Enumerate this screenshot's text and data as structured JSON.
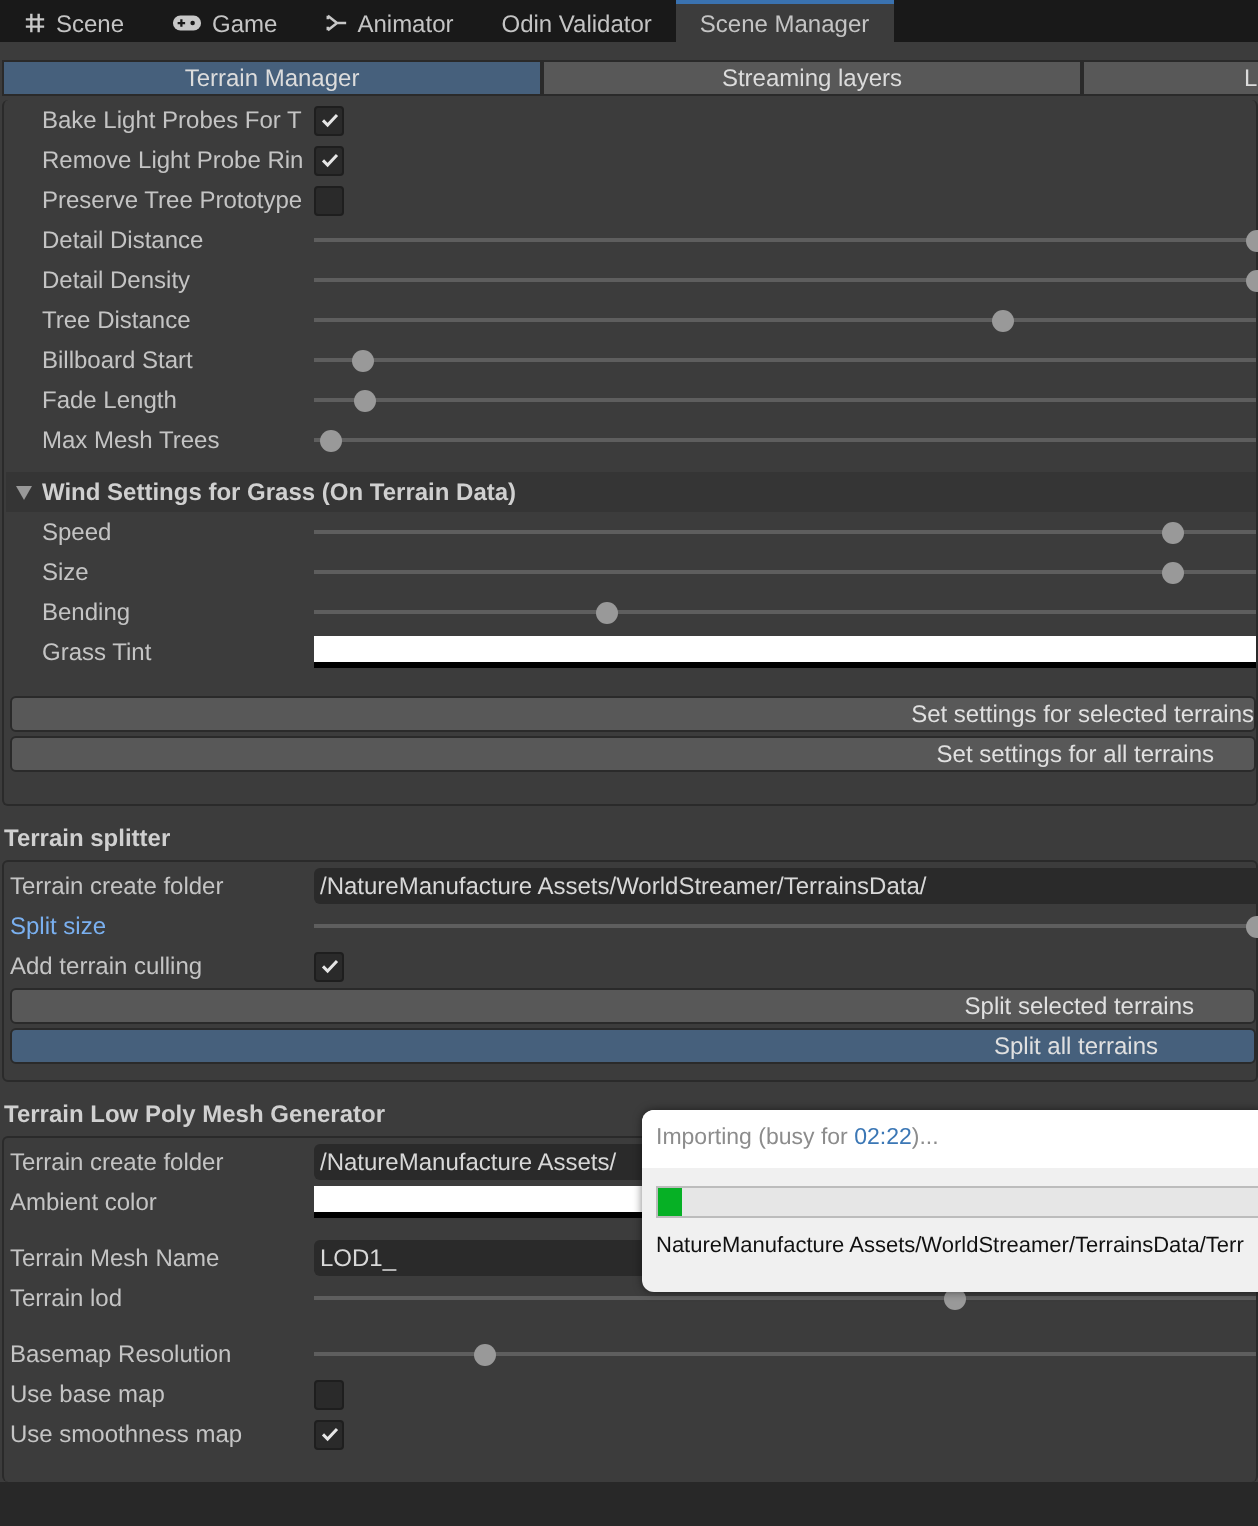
{
  "window_tabs": [
    {
      "label": "Scene",
      "selected": false
    },
    {
      "label": "Game",
      "selected": false
    },
    {
      "label": "Animator",
      "selected": false
    },
    {
      "label": "Odin Validator",
      "selected": false
    },
    {
      "label": "Scene Manager",
      "selected": true
    }
  ],
  "toolbar_tabs": [
    {
      "label": "Terrain Manager",
      "selected": true
    },
    {
      "label": "Streaming layers",
      "selected": false
    },
    {
      "label": "L",
      "selected": false
    }
  ],
  "terrain_settings": {
    "rows": [
      {
        "kind": "checkbox",
        "label": "Bake Light Probes For T",
        "checked": true
      },
      {
        "kind": "checkbox",
        "label": "Remove Light Probe Rin",
        "checked": true
      },
      {
        "kind": "checkbox",
        "label": "Preserve Tree Prototype",
        "checked": false
      },
      {
        "kind": "slider",
        "label": "Detail Distance",
        "level": 1
      },
      {
        "kind": "slider",
        "label": "Detail Density",
        "level": 1
      },
      {
        "kind": "slider",
        "label": "Tree Distance",
        "level": 0.73
      },
      {
        "kind": "slider",
        "label": "Billboard Start",
        "level": 0.05
      },
      {
        "kind": "slider",
        "label": "Fade Length",
        "level": 0.053
      },
      {
        "kind": "slider",
        "label": "Max Mesh Trees",
        "level": 0.017
      }
    ],
    "wind": {
      "title": "Wind Settings for Grass (On Terrain Data)",
      "expanded": true,
      "rows": [
        {
          "kind": "slider",
          "label": "Speed",
          "level": 0.91
        },
        {
          "kind": "slider",
          "label": "Size",
          "level": 0.91
        },
        {
          "kind": "slider",
          "label": "Bending",
          "level": 0.31
        },
        {
          "kind": "color",
          "label": "Grass Tint",
          "color": "#ffffff"
        }
      ]
    },
    "buttons": [
      {
        "label": "Set settings for selected terrains",
        "selected": false
      },
      {
        "label": "Set settings for all terrains",
        "selected": false
      }
    ]
  },
  "terrain_splitter": {
    "title": "Terrain splitter",
    "rows": [
      {
        "kind": "text",
        "label": "Terrain create folder",
        "value": "/NatureManufacture Assets/WorldStreamer/TerrainsData/"
      },
      {
        "kind": "slider",
        "label": "Split size",
        "modified": true,
        "level": 1
      },
      {
        "kind": "checkbox",
        "label": "Add terrain culling",
        "checked": true
      }
    ],
    "buttons": [
      {
        "label": "Split selected terrains",
        "selected": false
      },
      {
        "label": "Split all terrains",
        "selected": true
      }
    ]
  },
  "mesh_generator": {
    "title": "Terrain Low Poly Mesh Generator",
    "rows": [
      {
        "kind": "text",
        "label": "Terrain create folder",
        "value": "/NatureManufacture Assets/"
      },
      {
        "kind": "color",
        "label": "Ambient color",
        "color": "#ffffff"
      },
      {
        "kind": "text",
        "label": "Terrain Mesh Name",
        "value": "LOD1_"
      },
      {
        "kind": "slider",
        "label": "Terrain lod",
        "level": 0.68
      },
      {
        "kind": "slider",
        "label": "Basemap Resolution",
        "level": 0.18
      },
      {
        "kind": "checkbox",
        "label": "Use base map",
        "checked": false
      },
      {
        "kind": "checkbox",
        "label": "Use smoothness map",
        "checked": true
      }
    ]
  },
  "progress_dialog": {
    "title_before": "Importing (busy for ",
    "elapsed": "02:22",
    "title_after": ")...",
    "level": 0.04,
    "detail": "NatureManufacture Assets/WorldStreamer/TerrainsData/Terr"
  }
}
